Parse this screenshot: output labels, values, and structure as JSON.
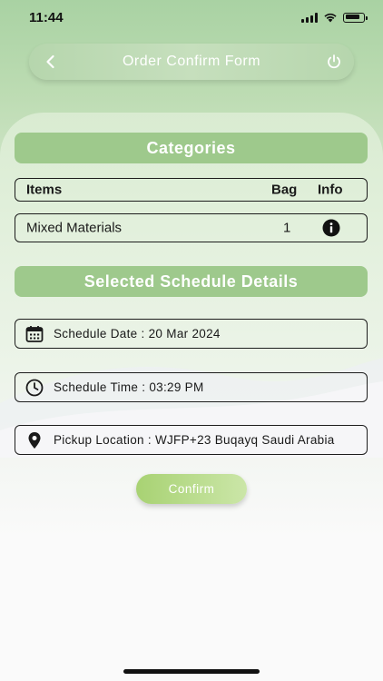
{
  "status_bar": {
    "time": "11:44"
  },
  "header": {
    "title": "Order Confirm Form",
    "back_icon": "chevron-left-icon",
    "power_icon": "power-icon"
  },
  "categories": {
    "title": "Categories",
    "columns": [
      "Items",
      "Bag",
      "Info"
    ],
    "rows": [
      {
        "item": "Mixed Materials",
        "bag": "1",
        "info_icon": "info-icon"
      }
    ]
  },
  "schedule": {
    "title": "Selected Schedule Details",
    "date": "Schedule Date : 20 Mar 2024",
    "time": "Schedule Time : 03:29 PM",
    "location": "Pickup Location : WJFP+23 Buqayq Saudi Arabia"
  },
  "confirm_label": "Confirm",
  "colors": {
    "accent": "#9ec98c",
    "button_start": "#a8d273",
    "button_end": "#cbe6a8"
  }
}
